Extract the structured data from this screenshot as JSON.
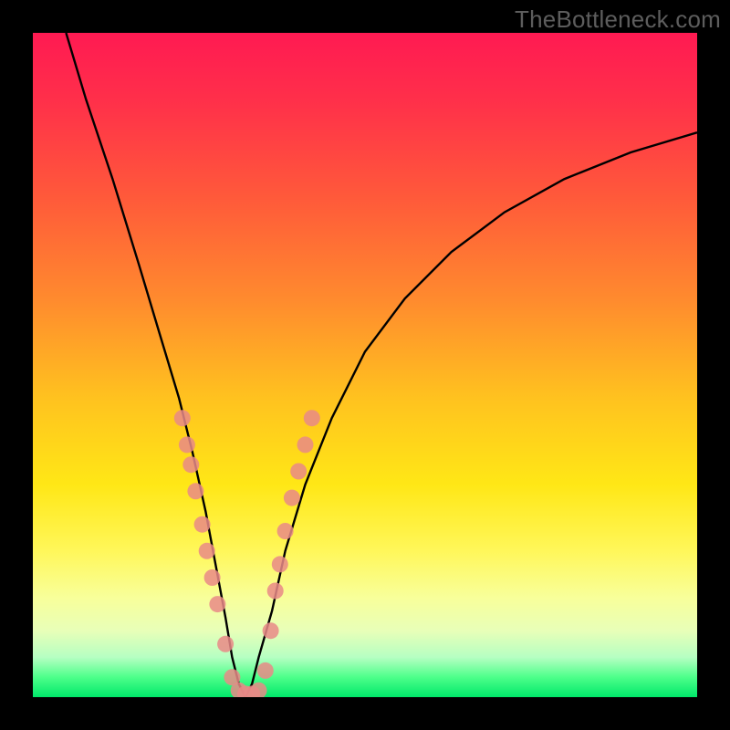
{
  "watermark": "TheBottleneck.com",
  "chart_data": {
    "type": "line",
    "title": "",
    "xlabel": "",
    "ylabel": "",
    "xlim": [
      0,
      100
    ],
    "ylim": [
      0,
      100
    ],
    "series": [
      {
        "name": "bottleneck-curve",
        "x": [
          5,
          8,
          12,
          16,
          19,
          22,
          24,
          26,
          27.5,
          29,
          30,
          31,
          32,
          33,
          34,
          36,
          38,
          41,
          45,
          50,
          56,
          63,
          71,
          80,
          90,
          100
        ],
        "y": [
          100,
          90,
          78,
          65,
          55,
          45,
          37,
          28,
          20,
          12,
          6,
          2,
          0,
          2,
          6,
          13,
          22,
          32,
          42,
          52,
          60,
          67,
          73,
          78,
          82,
          85
        ]
      }
    ],
    "markers": {
      "name": "highlight-points",
      "color": "#e98a87",
      "points": [
        {
          "x": 22.5,
          "y": 42
        },
        {
          "x": 23.2,
          "y": 38
        },
        {
          "x": 23.8,
          "y": 35
        },
        {
          "x": 24.5,
          "y": 31
        },
        {
          "x": 25.5,
          "y": 26
        },
        {
          "x": 26.2,
          "y": 22
        },
        {
          "x": 27.0,
          "y": 18
        },
        {
          "x": 27.8,
          "y": 14
        },
        {
          "x": 29.0,
          "y": 8
        },
        {
          "x": 30.0,
          "y": 3
        },
        {
          "x": 31.0,
          "y": 1
        },
        {
          "x": 32.0,
          "y": 0.5
        },
        {
          "x": 33.0,
          "y": 0.5
        },
        {
          "x": 34.0,
          "y": 1
        },
        {
          "x": 35.0,
          "y": 4
        },
        {
          "x": 35.8,
          "y": 10
        },
        {
          "x": 36.5,
          "y": 16
        },
        {
          "x": 37.2,
          "y": 20
        },
        {
          "x": 38.0,
          "y": 25
        },
        {
          "x": 39.0,
          "y": 30
        },
        {
          "x": 40.0,
          "y": 34
        },
        {
          "x": 41.0,
          "y": 38
        },
        {
          "x": 42.0,
          "y": 42
        }
      ]
    }
  }
}
